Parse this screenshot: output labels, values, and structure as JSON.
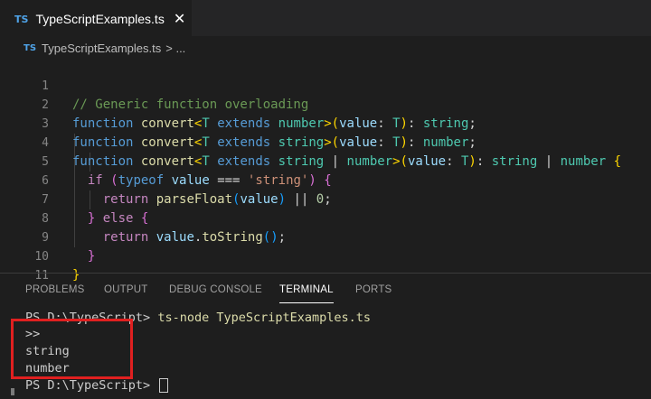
{
  "tab": {
    "badge": "TS",
    "label": "TypeScriptExamples.ts",
    "close_glyph": "✕"
  },
  "breadcrumb": {
    "badge": "TS",
    "file": "TypeScriptExamples.ts",
    "separator": "> ..."
  },
  "editor": {
    "line_numbers": [
      "1",
      "2",
      "3",
      "4",
      "5",
      "6",
      "7",
      "8",
      "9",
      "10",
      "11"
    ],
    "code": {
      "l1": {
        "comment": "// Generic function overloading"
      },
      "function_kw": "function",
      "fn_name": "convert",
      "type_param": "T",
      "extends_kw": "extends",
      "number_t": "number",
      "string_t": "string",
      "param_name": "value",
      "if_kw": "if",
      "typeof_kw": "typeof",
      "string_literal": "'string'",
      "return_kw": "return",
      "parse_float": "parseFloat",
      "zero": "0",
      "else_kw": "else",
      "to_string": "toString"
    }
  },
  "panel": {
    "tabs": [
      "PROBLEMS",
      "OUTPUT",
      "DEBUG CONSOLE",
      "TERMINAL",
      "PORTS"
    ],
    "active_tab": "TERMINAL"
  },
  "terminal": {
    "prompt1": "PS D:\\TypeScript> ",
    "command": "ts-node TypeScriptExamples.ts",
    "out1": ">>",
    "out2": "string",
    "out3": "number",
    "prompt2": "PS D:\\TypeScript> "
  },
  "colors": {
    "highlight_box": "#e02020",
    "editor_bg": "#1e1e1e",
    "keyword": "#569cd6"
  }
}
